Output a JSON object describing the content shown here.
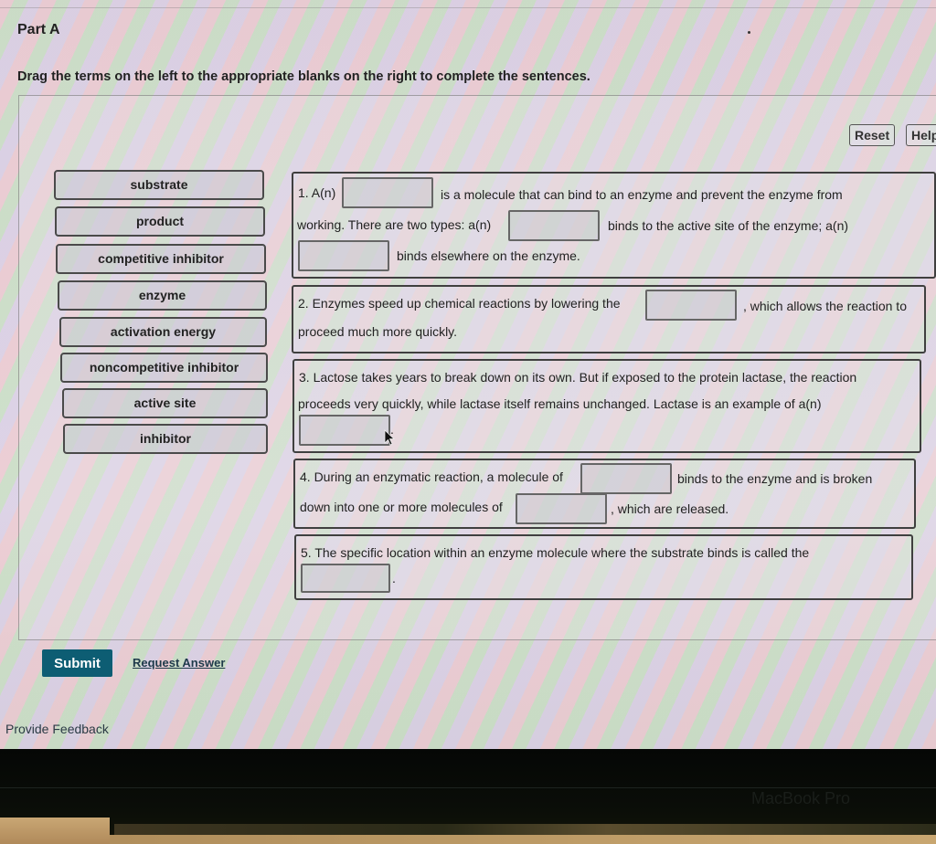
{
  "header": {
    "part_title": "Part A",
    "instructions": "Drag the terms on the left to the appropriate blanks on the right to complete the sentences."
  },
  "toolbar": {
    "reset_label": "Reset",
    "help_label": "Help"
  },
  "terms": [
    {
      "label": "substrate"
    },
    {
      "label": "product"
    },
    {
      "label": "competitive inhibitor"
    },
    {
      "label": "enzyme"
    },
    {
      "label": "activation energy"
    },
    {
      "label": "noncompetitive inhibitor"
    },
    {
      "label": "active site"
    },
    {
      "label": "inhibitor"
    }
  ],
  "sentences": {
    "s1": {
      "t1": "1. A(n)",
      "t2": "is a molecule that can bind to an enzyme and prevent the enzyme from",
      "t3": "working. There are two types: a(n)",
      "t4": "binds to the active site of the enzyme; a(n)",
      "t5": "binds elsewhere on the enzyme."
    },
    "s2": {
      "t1": "2. Enzymes speed up chemical reactions by lowering the",
      "t2": ", which allows the reaction to",
      "t3": "proceed much more quickly."
    },
    "s3": {
      "t1": "3. Lactose takes years to break down on its own. But if exposed to the protein lactase, the reaction",
      "t2": "proceeds very quickly, while lactase itself remains unchanged. Lactase is an example of a(n)",
      "t3": "."
    },
    "s4": {
      "t1": "4. During an enzymatic reaction, a molecule of",
      "t2": "binds to the enzyme and is broken",
      "t3": "down into one or more molecules of",
      "t4": ", which are released."
    },
    "s5": {
      "t1": "5. The specific location within an enzyme molecule where the substrate binds is called the",
      "t2": "."
    }
  },
  "actions": {
    "submit_label": "Submit",
    "request_answer_label": "Request Answer",
    "feedback_label": "Provide Feedback"
  },
  "device": {
    "brand_text": "MacBook Pro"
  },
  "colors": {
    "submit_bg": "#0d5d73"
  }
}
